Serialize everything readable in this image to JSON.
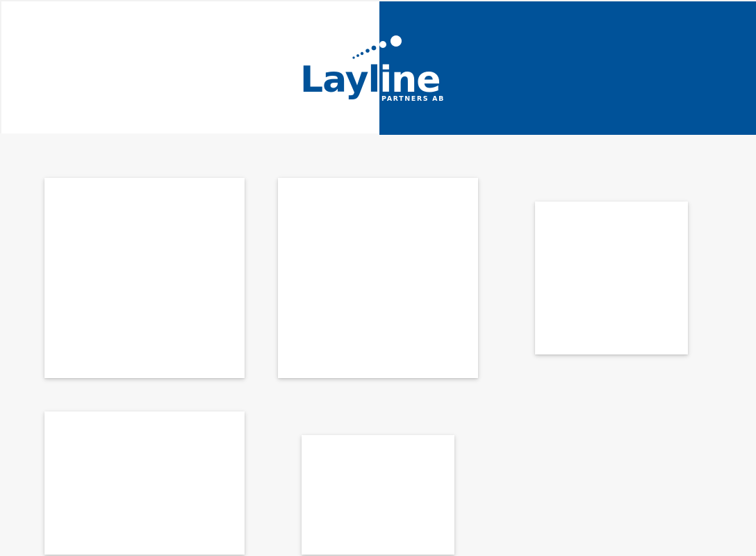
{
  "brand": {
    "name": "Layline",
    "tagline": "PARTNERS AB",
    "colors": {
      "primary": "#005299",
      "white": "#ffffff",
      "page_background": "#f7f7f7"
    }
  },
  "tiles": [
    {
      "id": 1
    },
    {
      "id": 2
    },
    {
      "id": 3
    },
    {
      "id": 4
    },
    {
      "id": 5
    }
  ]
}
